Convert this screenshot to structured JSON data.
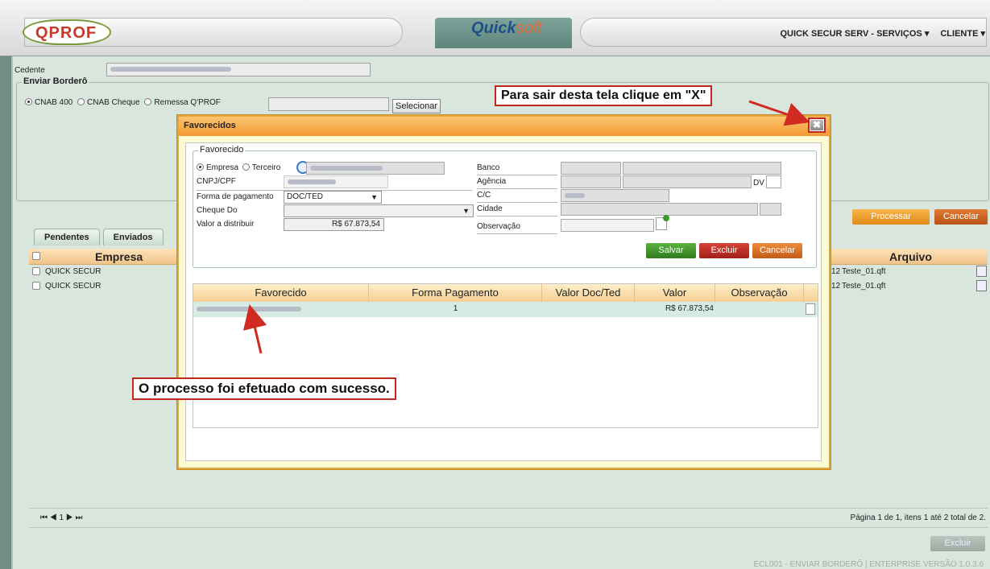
{
  "topbar": {
    "logo_text": "QPROF",
    "brand_main": "Quick",
    "brand_accent": "soft",
    "company": "QUICK SECUR SERV - SERVIÇOS",
    "profile": "CLIENTE"
  },
  "form": {
    "cedente_label": "Cedente",
    "enviar_bordero_legend": "Enviar Borderô",
    "radios": [
      "CNAB 400",
      "CNAB Cheque",
      "Remessa Q'PROF"
    ],
    "selecionar_button": "Selecionar",
    "processar_button": "Processar",
    "cancelar_button": "Cancelar"
  },
  "tabs": [
    "Pendentes",
    "Enviados"
  ],
  "grid": {
    "columns": {
      "empresa": "Empresa",
      "arquivo": "Arquivo"
    },
    "rows": [
      {
        "empresa": "QUICK SECUR",
        "arquivo_prefix": "12",
        "arquivo": "Teste_01.qft"
      },
      {
        "empresa": "QUICK SECUR",
        "arquivo_prefix": "12",
        "arquivo": "Teste_01.qft"
      }
    ]
  },
  "pager": {
    "controls": "⏮ ◀ 1 ▶ ⏭",
    "summary": "Página 1 de 1, itens 1 até 2 total de 2."
  },
  "excluir_button": "Excluir",
  "footer_text": "ECL001 - ENVIAR BORDERÔ | ENTERPRISE VERSÃO 1.0.3.6",
  "modal": {
    "title": "Favorecidos",
    "favorecido_legend": "Favorecido",
    "empresa_radio": "Empresa",
    "terceiro_radio": "Terceiro",
    "cnpj_label": "CNPJ/CPF",
    "forma_pagamento_label": "Forma de pagamento",
    "forma_pagamento_value": "DOC/TED",
    "cheque_do_label": "Cheque Do",
    "valor_distribuir_label": "Valor a distribuir",
    "valor_distribuir_value": "R$ 67.873,54",
    "banco_label": "Banco",
    "agencia_label": "Agência",
    "dv_label": "DV",
    "cc_label": "C/C",
    "cidade_label": "Cidade",
    "observacao_label": "Observação",
    "salvar_button": "Salvar",
    "excluir_button": "Excluir",
    "cancelar_button": "Cancelar",
    "grid_columns": [
      "Favorecido",
      "Forma Pagamento",
      "Valor Doc/Ted",
      "Valor",
      "Observação"
    ],
    "grid_row": {
      "forma_pagamento": "1",
      "valor": "R$ 67.873,54"
    }
  },
  "annotations": {
    "close_hint": "Para sair desta tela clique em \"X\"",
    "success": "O processo foi efetuado com sucesso."
  },
  "icons": [
    "search-icon",
    "add-note-icon",
    "edit-icon",
    "close-icon",
    "dropdown-arrow-icon"
  ],
  "colors": {
    "accent_orange": "#f29a34",
    "save_green": "#3d8a2a",
    "delete_red": "#c0281e",
    "annotation_red": "#c0281e"
  }
}
